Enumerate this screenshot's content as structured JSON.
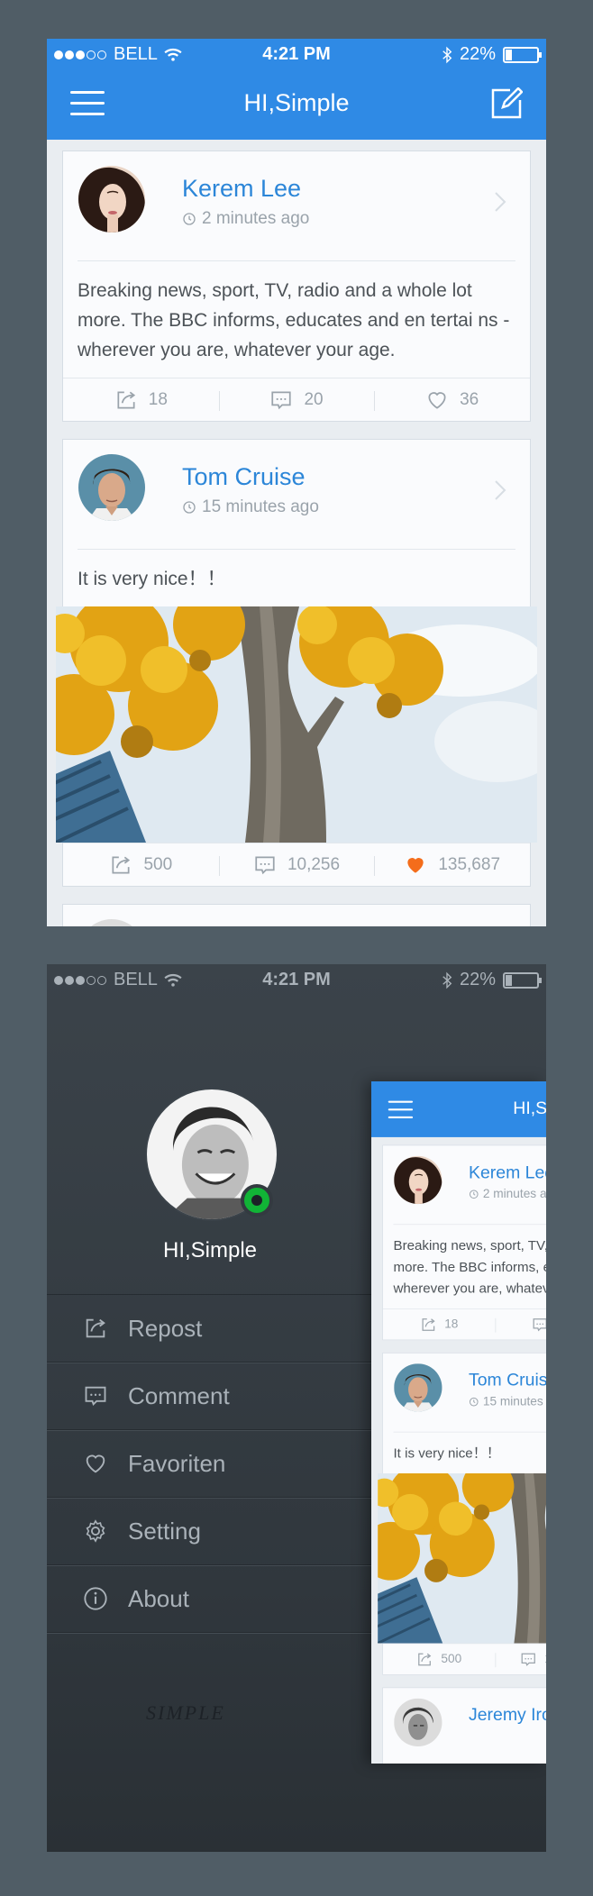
{
  "status": {
    "carrier": "BELL",
    "time": "4:21 PM",
    "battery": "22%"
  },
  "app": {
    "title": "HI,Simple"
  },
  "feed": {
    "posts": [
      {
        "author": "Kerem Lee",
        "time": "2 minutes ago",
        "text": "Breaking news, sport, TV, radio and a whole lot more. The BBC informs, educates and en tertai ns - wherever you are, whatever your age.",
        "reposts": "18",
        "comments": "20",
        "likes": "36"
      },
      {
        "author": "Tom Cruise",
        "time": "15 minutes ago",
        "text": "It is very nice！！",
        "reposts": "500",
        "comments": "10,256",
        "likes": "135,687",
        "liked": true
      },
      {
        "author": "Jeremy Irons"
      }
    ]
  },
  "drawer": {
    "profile_name": "HI,Simple",
    "online": true,
    "menu": [
      {
        "label": "Repost",
        "icon": "repost-icon"
      },
      {
        "label": "Comment",
        "icon": "comment-icon"
      },
      {
        "label": "Favoriten",
        "icon": "heart-icon"
      },
      {
        "label": "Setting",
        "icon": "gear-icon"
      },
      {
        "label": "About",
        "icon": "info-icon"
      }
    ],
    "signature": "SIMPLE"
  },
  "colors": {
    "accent": "#2f8ae5",
    "like": "#f46d1b",
    "online": "#11b436"
  }
}
